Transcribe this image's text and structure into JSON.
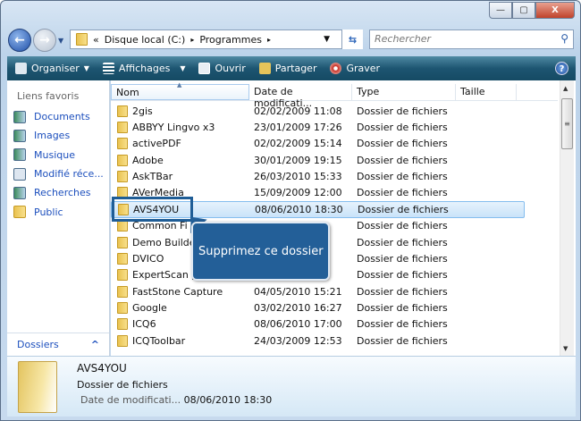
{
  "window": {
    "minimize": "▭",
    "maximize": "▢",
    "close": "X"
  },
  "address": {
    "prefix": "«",
    "segments": [
      "Disque local (C:)",
      "Programmes"
    ],
    "sep": "▸"
  },
  "search": {
    "placeholder": "Rechercher"
  },
  "toolbar": {
    "items": [
      "Organiser",
      "Affichages",
      "Ouvrir",
      "Partager",
      "Graver"
    ],
    "help": "?"
  },
  "sidebar": {
    "heading": "Liens favoris",
    "items": [
      "Documents",
      "Images",
      "Musique",
      "Modifié réce...",
      "Recherches",
      "Public"
    ],
    "folders": "Dossiers"
  },
  "columns": [
    "Nom",
    "Date de modificati...",
    "Type",
    "Taille"
  ],
  "files": [
    {
      "name": "2gis",
      "date": "02/02/2009 11:08",
      "type": "Dossier de fichiers"
    },
    {
      "name": "ABBYY Lingvo x3",
      "date": "23/01/2009 17:26",
      "type": "Dossier de fichiers"
    },
    {
      "name": "activePDF",
      "date": "02/02/2009 15:14",
      "type": "Dossier de fichiers"
    },
    {
      "name": "Adobe",
      "date": "30/01/2009 19:15",
      "type": "Dossier de fichiers"
    },
    {
      "name": "AskTBar",
      "date": "26/03/2010 15:33",
      "type": "Dossier de fichiers"
    },
    {
      "name": "AVerMedia",
      "date": "15/09/2009 12:00",
      "type": "Dossier de fichiers"
    },
    {
      "name": "AVS4YOU",
      "date": "08/06/2010 18:30",
      "type": "Dossier de fichiers"
    },
    {
      "name": "Common Fi",
      "date": "",
      "type": "Dossier de fichiers"
    },
    {
      "name": "Demo Builde",
      "date": "",
      "type": "Dossier de fichiers"
    },
    {
      "name": "DVICO",
      "date": "",
      "type": "Dossier de fichiers"
    },
    {
      "name": "ExpertScan p",
      "date": "",
      "type": "Dossier de fichiers"
    },
    {
      "name": "FastStone Capture",
      "date": "04/05/2010 15:21",
      "type": "Dossier de fichiers"
    },
    {
      "name": "Google",
      "date": "03/02/2010 16:27",
      "type": "Dossier de fichiers"
    },
    {
      "name": "ICQ6",
      "date": "08/06/2010 17:00",
      "type": "Dossier de fichiers"
    },
    {
      "name": "ICQToolbar",
      "date": "24/03/2009 12:53",
      "type": "Dossier de fichiers"
    }
  ],
  "callout": "Supprimez ce dossier",
  "details": {
    "name": "AVS4YOU",
    "type": "Dossier de fichiers",
    "date_label": "Date de modificati...",
    "date": "08/06/2010 18:30"
  }
}
